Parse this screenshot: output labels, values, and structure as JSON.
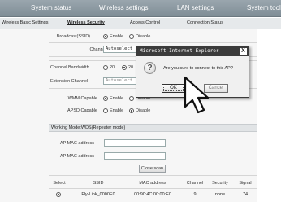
{
  "topnav": {
    "items": [
      "System status",
      "Wireless settings",
      "LAN settings",
      "System tools"
    ]
  },
  "subnav": {
    "items": [
      "Wireless Basic Settings",
      "Wireless Security",
      "Access Control",
      "Connection Status"
    ]
  },
  "basic": {
    "broadcast_label": "Broadcast(SSID)",
    "broadcast_enable": "Enable",
    "broadcast_disable": "Disable",
    "channel_label": "Channel",
    "channel_value": "Autoselect",
    "bandwidth_label": "Channel Bandwidth",
    "bw_20": "20",
    "bw_2040": "20",
    "ext_channel_label": "Extension Channel",
    "ext_channel_value": "Autoselect",
    "wmm_label": "WMM Capable",
    "wmm_enable": "Enable",
    "wmm_disable": "Disable",
    "apsd_label": "APSD Capable",
    "apsd_enable": "Enable",
    "apsd_disable": "Disable"
  },
  "wds": {
    "section_title": "Working Mode:WDS(Repeater mode)",
    "mac_label_1": "AP MAC address",
    "mac_label_2": "AP MAC address",
    "close_scan": "Close scan"
  },
  "scan_table": {
    "headers": [
      "Select",
      "SSID",
      "MAC address",
      "Channel",
      "Security",
      "Signal"
    ],
    "rows": [
      [
        "Fly-Link_0000E0",
        "00:90:4C:00:00:E0",
        "9",
        "none",
        "74"
      ]
    ]
  },
  "dialog": {
    "title": "Microsoft Internet Explorer",
    "close": "X",
    "icon": "?",
    "message": "Are you sure to connect to this AP?",
    "ok": "OK",
    "cancel": "Cancel"
  }
}
